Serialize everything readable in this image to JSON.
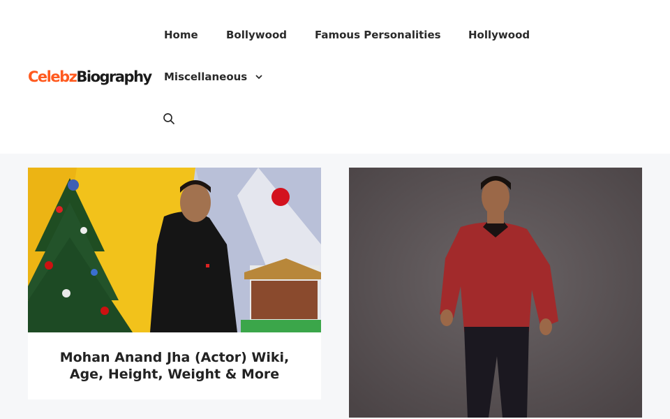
{
  "header": {
    "logo": {
      "part1": "Celebz",
      "part2": "Biography"
    },
    "nav": [
      {
        "label": "Home"
      },
      {
        "label": "Bollywood"
      },
      {
        "label": "Famous Personalities"
      },
      {
        "label": "Hollywood"
      },
      {
        "label": "Miscellaneous",
        "icon": "chevron-down-icon"
      }
    ],
    "search_icon": "search-icon"
  },
  "posts": [
    {
      "title": "Mohan Anand Jha (Actor) Wiki, Age, Height, Weight & More",
      "image": "young man in black t-shirt beside a christmas tree"
    },
    {
      "title": "",
      "image": "man in red shirt and dark jeans against grey backdrop"
    }
  ],
  "colors": {
    "logo_accent": "#ff5a1f",
    "logo_dark": "#1a1a1a",
    "header_bg": "#ffffff",
    "page_bg": "#f6f7f9",
    "nav_text": "#2a2a2a"
  }
}
